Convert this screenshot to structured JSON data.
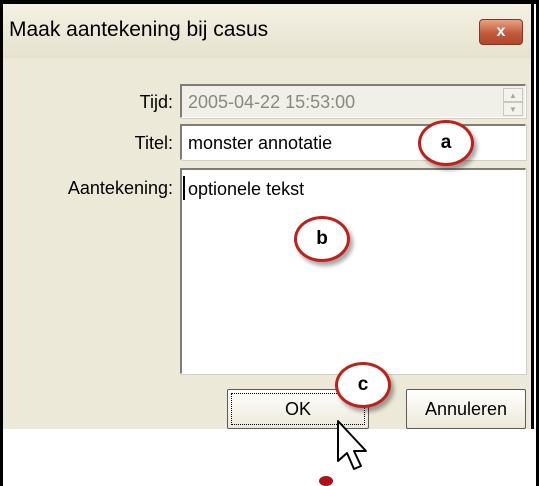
{
  "dialog": {
    "title": "Maak aantekening bij casus",
    "close_label": "x"
  },
  "fields": {
    "tijd_label": "Tijd:",
    "tijd_value": "2005-04-22 15:53:00",
    "titel_label": "Titel:",
    "titel_value": "monster annotatie",
    "aantekening_label": "Aantekening:",
    "aantekening_value": "optionele tekst"
  },
  "buttons": {
    "ok_label": "OK",
    "cancel_label": "Annuleren"
  },
  "callouts": {
    "a": "a",
    "b": "b",
    "c": "c"
  },
  "icons": {
    "spinner_up": "spin-up-icon",
    "spinner_down": "spin-down-icon",
    "close": "close-icon",
    "cursor": "mouse-cursor-icon"
  },
  "colors": {
    "dialog_bg": "#ece9d8",
    "close_button": "#c25a3c",
    "callout_border": "#c0201c"
  }
}
